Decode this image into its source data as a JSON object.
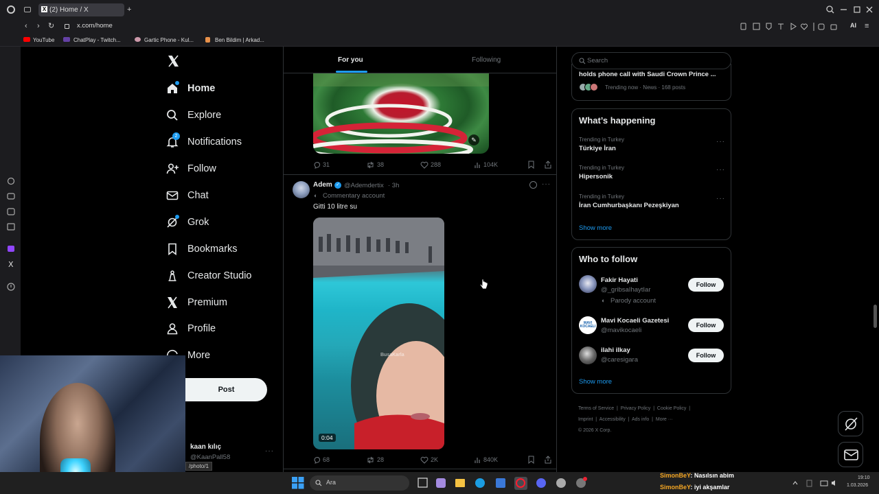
{
  "browser": {
    "tab_title": "(2) Home / X",
    "url": "x.com/home",
    "bookmarks": [
      "YouTube",
      "ChatPlay - Twitch...",
      "Gartic Phone - Kul...",
      "Ben Bildim | Arkad..."
    ],
    "ai_label": "AI"
  },
  "nav": {
    "items": [
      {
        "label": "Home",
        "icon": "home-icon"
      },
      {
        "label": "Explore",
        "icon": "search-icon"
      },
      {
        "label": "Notifications",
        "icon": "bell-icon",
        "badge": "2"
      },
      {
        "label": "Follow",
        "icon": "add-person-icon"
      },
      {
        "label": "Chat",
        "icon": "mail-icon"
      },
      {
        "label": "Grok",
        "icon": "grok-icon"
      },
      {
        "label": "Bookmarks",
        "icon": "bookmark-icon"
      },
      {
        "label": "Creator Studio",
        "icon": "creator-icon"
      },
      {
        "label": "Premium",
        "icon": "x-logo-icon"
      },
      {
        "label": "Profile",
        "icon": "person-icon"
      },
      {
        "label": "More",
        "icon": "more-icon"
      }
    ],
    "post_button": "Post",
    "account": {
      "name": "kaan kılıç",
      "handle": "@KaanPall58"
    },
    "status_url": "/photo/1"
  },
  "feed": {
    "tabs": [
      "For you",
      "Following"
    ],
    "prev_post_actions": {
      "replies": "31",
      "reposts": "38",
      "likes": "288",
      "views": "104K"
    },
    "post": {
      "name": "Adem",
      "handle": "@Ademdertix",
      "time": "· 3h",
      "label": "Commentary account",
      "text": "Gitti 10 litre su",
      "watermark": "BusaKarla",
      "video_time": "0:04",
      "actions": {
        "replies": "68",
        "reposts": "28",
        "likes": "2K",
        "views": "840K"
      }
    }
  },
  "right": {
    "search_placeholder": "Search",
    "top_trend": {
      "title": "holds phone call with Saudi Crown Prince ...",
      "meta": "Trending now · News · 168 posts"
    },
    "happening": {
      "title": "What’s happening",
      "trends": [
        {
          "context": "Trending in Turkey",
          "name": "Türkiye İran"
        },
        {
          "context": "Trending in Turkey",
          "name": "Hipersonik"
        },
        {
          "context": "Trending in Turkey",
          "name": "İran Cumhurbaşkanı Pezeşkiyan"
        }
      ],
      "show_more": "Show more"
    },
    "who_to_follow": {
      "title": "Who to follow",
      "users": [
        {
          "name": "Fakir Hayati",
          "handle": "@_gribsaIhaytIar",
          "label": "Parody account",
          "button": "Follow"
        },
        {
          "name": "Mavi Kocaeli Gazetesi",
          "handle": "@mavikocaeli",
          "button": "Follow"
        },
        {
          "name": "ilahi ilkay",
          "handle": "@caresigara",
          "button": "Follow"
        }
      ],
      "show_more": "Show more",
      "avatar_text": "MAVI KOCAELI"
    },
    "footer": {
      "links": [
        "Terms of Service",
        "Privacy Policy",
        "Cookie Policy",
        "Imprint",
        "Accessibility",
        "Ads info",
        "More ···"
      ],
      "copyright": "© 2026 X Corp."
    }
  },
  "taskbar": {
    "search_placeholder": "Ara",
    "chat": [
      {
        "user": "SimonBeY",
        "msg": ": Nasılsın abim"
      },
      {
        "user": "SimonBeY",
        "msg": ": iyi akşamlar"
      }
    ],
    "clock_time": "19:10",
    "clock_date": "1.03.2026"
  },
  "colors": {
    "accent": "#1d9bf0",
    "chat_user": "#f5a623"
  }
}
